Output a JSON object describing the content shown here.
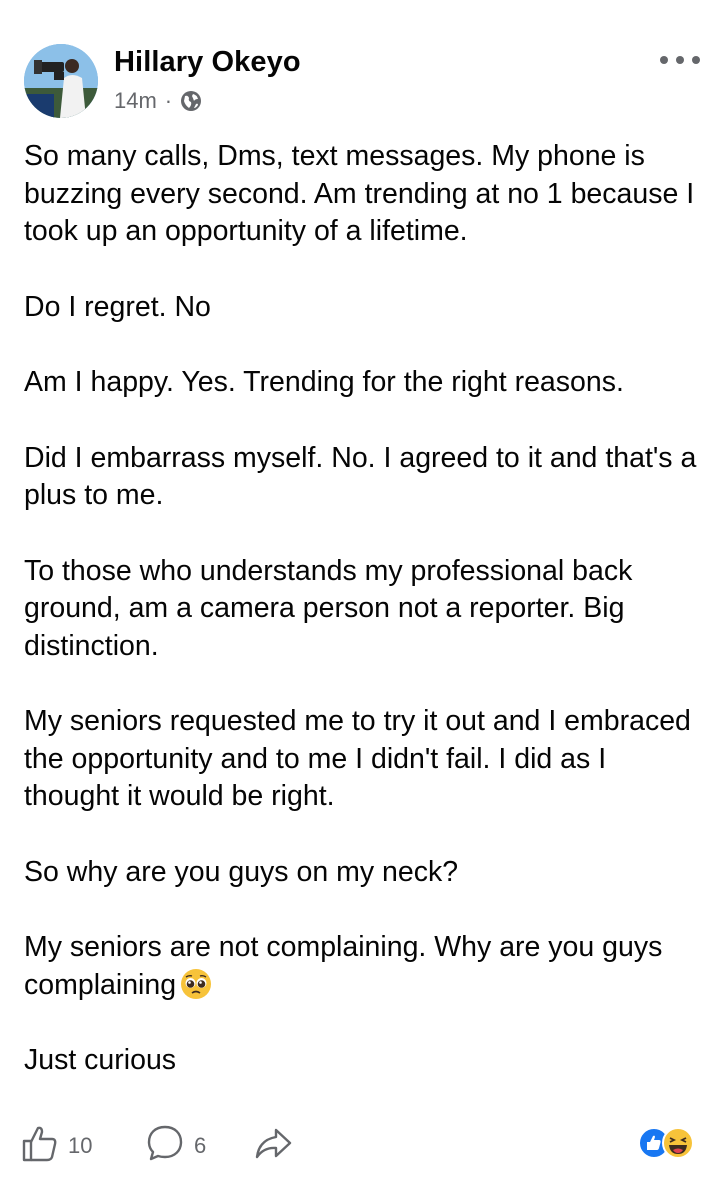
{
  "post": {
    "author": "Hillary Okeyo",
    "timestamp": "14m",
    "separator": "·",
    "privacy_icon": "globe-icon",
    "menu_icon": "more-horizontal-icon",
    "paragraphs": [
      "So many calls, Dms, text messages. My phone is buzzing every second. Am trending at no 1 because I took up an opportunity of a lifetime.",
      "Do I regret. No",
      "Am I happy. Yes. Trending for the right reasons.",
      "Did I embarrass myself. No. I agreed to it and that's a plus to me.",
      "To those who understands my professional back ground, am a camera person not a reporter. Big distinction.",
      "My seniors requested me to try it out and I embraced the opportunity and to me I didn't fail. I did as I thought it would be right.",
      "So why are you guys on my neck?",
      "My seniors are not complaining. Why are you guys complaining",
      "Just curious"
    ],
    "inline_emoji": "pleading-face-emoji"
  },
  "actions": {
    "like_count": "10",
    "comment_count": "6",
    "reactions": [
      "like",
      "laughing"
    ]
  },
  "colors": {
    "text": "#050505",
    "secondary": "#65676b",
    "like_blue": "#1877f2",
    "emoji_yellow": "#f7c33a"
  }
}
